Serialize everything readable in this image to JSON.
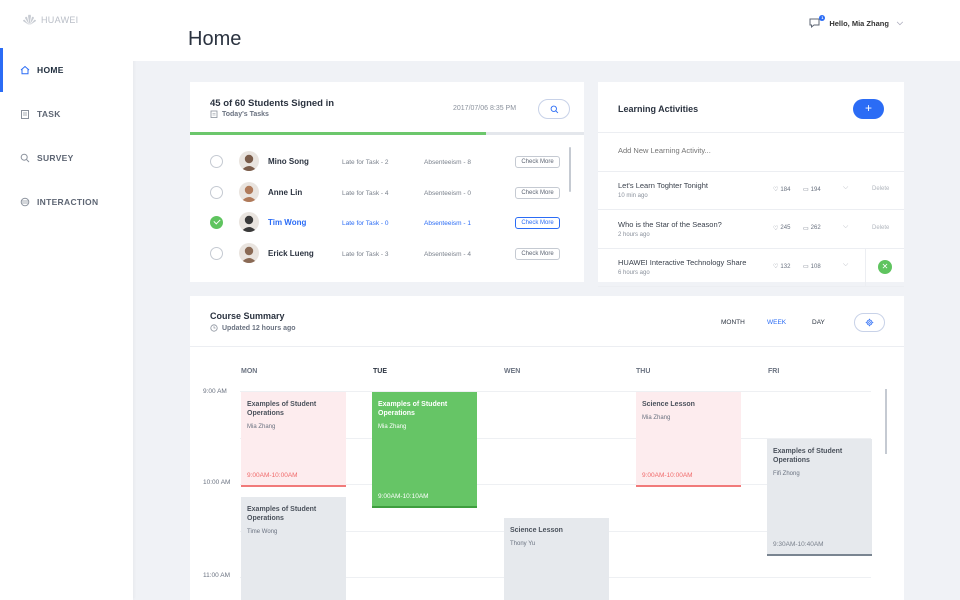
{
  "brand": "HUAWEI",
  "nav": [
    {
      "label": "HOME",
      "icon": "home-icon"
    },
    {
      "label": "TASK",
      "icon": "clipboard-icon"
    },
    {
      "label": "SURVEY",
      "icon": "survey-icon"
    },
    {
      "label": "INTERACTION",
      "icon": "interaction-icon"
    }
  ],
  "header": {
    "title": "Home",
    "greeting": "Hello, Mia Zhang",
    "notifications": "1"
  },
  "signin": {
    "title": "45 of 60 Students Signed in",
    "subtitle": "Today's Tasks",
    "datetime": "2017/07/06 8:35 PM",
    "progress": 0.75,
    "students": [
      {
        "name": "Mino Song",
        "late": "Late for Task - 2",
        "absent": "Absenteeism - 8",
        "action": "Check More",
        "checked": false
      },
      {
        "name": "Anne Lin",
        "late": "Late for Task - 4",
        "absent": "Absenteeism - 0",
        "action": "Check More",
        "checked": false
      },
      {
        "name": "Tim Wong",
        "late": "Late for Task - 0",
        "absent": "Absenteeism - 1",
        "action": "Check More",
        "checked": true
      },
      {
        "name": "Erick Lueng",
        "late": "Late for Task - 3",
        "absent": "Absenteeism - 4",
        "action": "Check More",
        "checked": false
      }
    ]
  },
  "learning": {
    "title": "Learning Activities",
    "add_label": "+",
    "input_placeholder": "Add New Learning Activity...",
    "activities": [
      {
        "title": "Let's Learn Toghter Tonight",
        "time": "10 min ago",
        "likes": "184",
        "comments": "194",
        "action": "Delete"
      },
      {
        "title": "Who is the Star of the Season?",
        "time": "2 hours ago",
        "likes": "245",
        "comments": "262",
        "action": "Delete"
      },
      {
        "title": "HUAWEI Interactive Technology Share",
        "time": "6 hours ago",
        "likes": "132",
        "comments": "108",
        "action": ""
      }
    ]
  },
  "course": {
    "title": "Course Summary",
    "subtitle": "Updated 12 hours ago",
    "periods": [
      "MONTH",
      "WEEK",
      "DAY"
    ],
    "active_period": "WEEK",
    "days": [
      "MON",
      "TUE",
      "WEN",
      "THU",
      "FRI"
    ],
    "times": [
      "9:00 AM",
      "10:00 AM",
      "11:00 AM"
    ],
    "events": [
      {
        "title": "Examples of Student Operations",
        "who": "Mia Zhang",
        "time": "9:00AM-10:00AM",
        "style": "pink"
      },
      {
        "title": "Examples of Student Operations",
        "who": "Mia Zhang",
        "time": "9:00AM-10:10AM",
        "style": "green"
      },
      {
        "title": "Science Lesson",
        "who": "Mia Zhang",
        "time": "9:00AM-10:00AM",
        "style": "pink"
      },
      {
        "title": "Examples of Student Operations",
        "who": "Fifi Zhong",
        "time": "9:30AM-10:40AM",
        "style": "grey"
      },
      {
        "title": "Examples of Student Operations",
        "who": "Time Wong",
        "time": "",
        "style": "grey"
      },
      {
        "title": "Science Lesson",
        "who": "Thony Yu",
        "time": "",
        "style": "grey"
      }
    ]
  }
}
